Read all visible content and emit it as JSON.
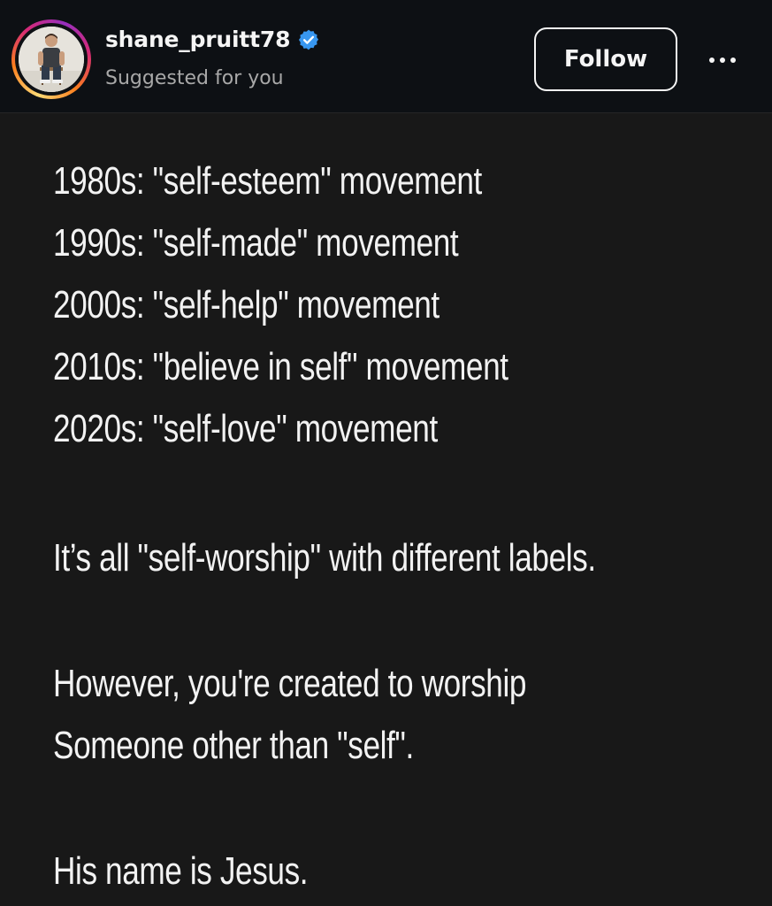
{
  "post": {
    "author": {
      "username": "shane_pruitt78",
      "subtitle": "Suggested for you",
      "verified": true,
      "verified_icon": "verified-badge-icon",
      "verified_color": "#3897f0"
    },
    "follow_label": "Follow",
    "more_icon": "more-options-icon",
    "lines": [
      "1980s: \"self-esteem\" movement",
      "1990s: \"self-made\" movement",
      "2000s: \"self-help\" movement",
      "2010s: \"believe in self\" movement",
      "2020s: \"self-love\" movement",
      "It’s all \"self-worship\" with different labels.",
      "However, you're created to worship",
      "Someone other than \"self\".",
      "His name is Jesus."
    ]
  },
  "colors": {
    "header_bg": "#0d1014",
    "body_bg": "#181818",
    "text": "#f2f2f2",
    "muted": "#a8a8a8"
  }
}
